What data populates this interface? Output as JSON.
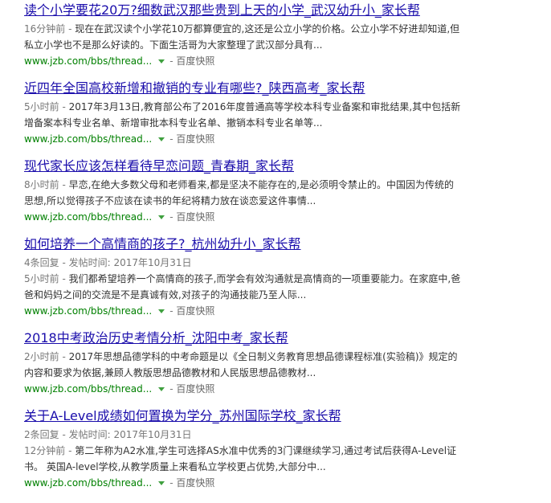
{
  "results": [
    {
      "title": "读个小学要花20万?细数武汉那些贵到上天的小学_武汉幼升小_家长帮",
      "time": "16分钟前 - ",
      "snippet": "现在在武汉读个小学花10万都算便宜的,这还是公立小学的价格。公立小学不好进却知道,但私立小学也不是那么好读的。下面生活哥为大家整理了武汉部分具有...",
      "url": "www.jzb.com/bbs/thread...",
      "separator": "-",
      "snapshot": "百度快照"
    },
    {
      "title": "近四年全国高校新增和撤销的专业有哪些?_陕西高考_家长帮",
      "time": "5小时前 - ",
      "snippet": "2017年3月13日,教育部公布了2016年度普通高等学校本科专业备案和审批结果,其中包括新增备案本科专业名单、新增审批本科专业名单、撤销本科专业名单等...",
      "url": "www.jzb.com/bbs/thread...",
      "separator": "-",
      "snapshot": "百度快照"
    },
    {
      "title": "现代家长应该怎样看待早恋问题_青春期_家长帮",
      "time": "8小时前 - ",
      "snippet": "早恋,在绝大多数父母和老师看来,都是坚决不能存在的,是必须明令禁止的。中国因为传统的思想,所以觉得孩子不应该在读书的年纪将精力放在谈恋爱这件事情...",
      "url": "www.jzb.com/bbs/thread...",
      "separator": "-",
      "snapshot": "百度快照"
    },
    {
      "title": "如何培养一个高情商的孩子?_杭州幼升小_家长帮",
      "meta": "4条回复 - 发帖时间: 2017年10月31日",
      "time": "5小时前 - ",
      "snippet": "我们都希望培养一个高情商的孩子,而学会有效沟通就是高情商的一项重要能力。在家庭中,爸爸和妈妈之间的交流是不是真诚有效,对孩子的沟通技能乃至人际...",
      "url": "www.jzb.com/bbs/thread...",
      "separator": "-",
      "snapshot": "百度快照"
    },
    {
      "title": "2018中考政治历史考情分析_沈阳中考_家长帮",
      "time": "2小时前 - ",
      "snippet": "2017年思想品德学科的中考命题是以《全日制义务教育思想品德课程标准(实验稿)》规定的内容和要求为依据,兼顾人教版思想品德教材和人民版思想品德教材...",
      "url": "www.jzb.com/bbs/thread...",
      "separator": "-",
      "snapshot": "百度快照"
    },
    {
      "title": "关于A-Level成绩如何置换为学分_苏州国际学校_家长帮",
      "meta": "2条回复 - 发帖时间: 2017年10月31日",
      "time": "12分钟前 - ",
      "snippet": "第二年称为A2水准,学生可选择AS水准中优秀的3门课继续学习,通过考试后获得A-Level证书。 英国A-level学校,从教学质量上来看私立学校更占优势,大部分中...",
      "url": "www.jzb.com/bbs/thread...",
      "separator": "-",
      "snapshot": "百度快照"
    }
  ]
}
